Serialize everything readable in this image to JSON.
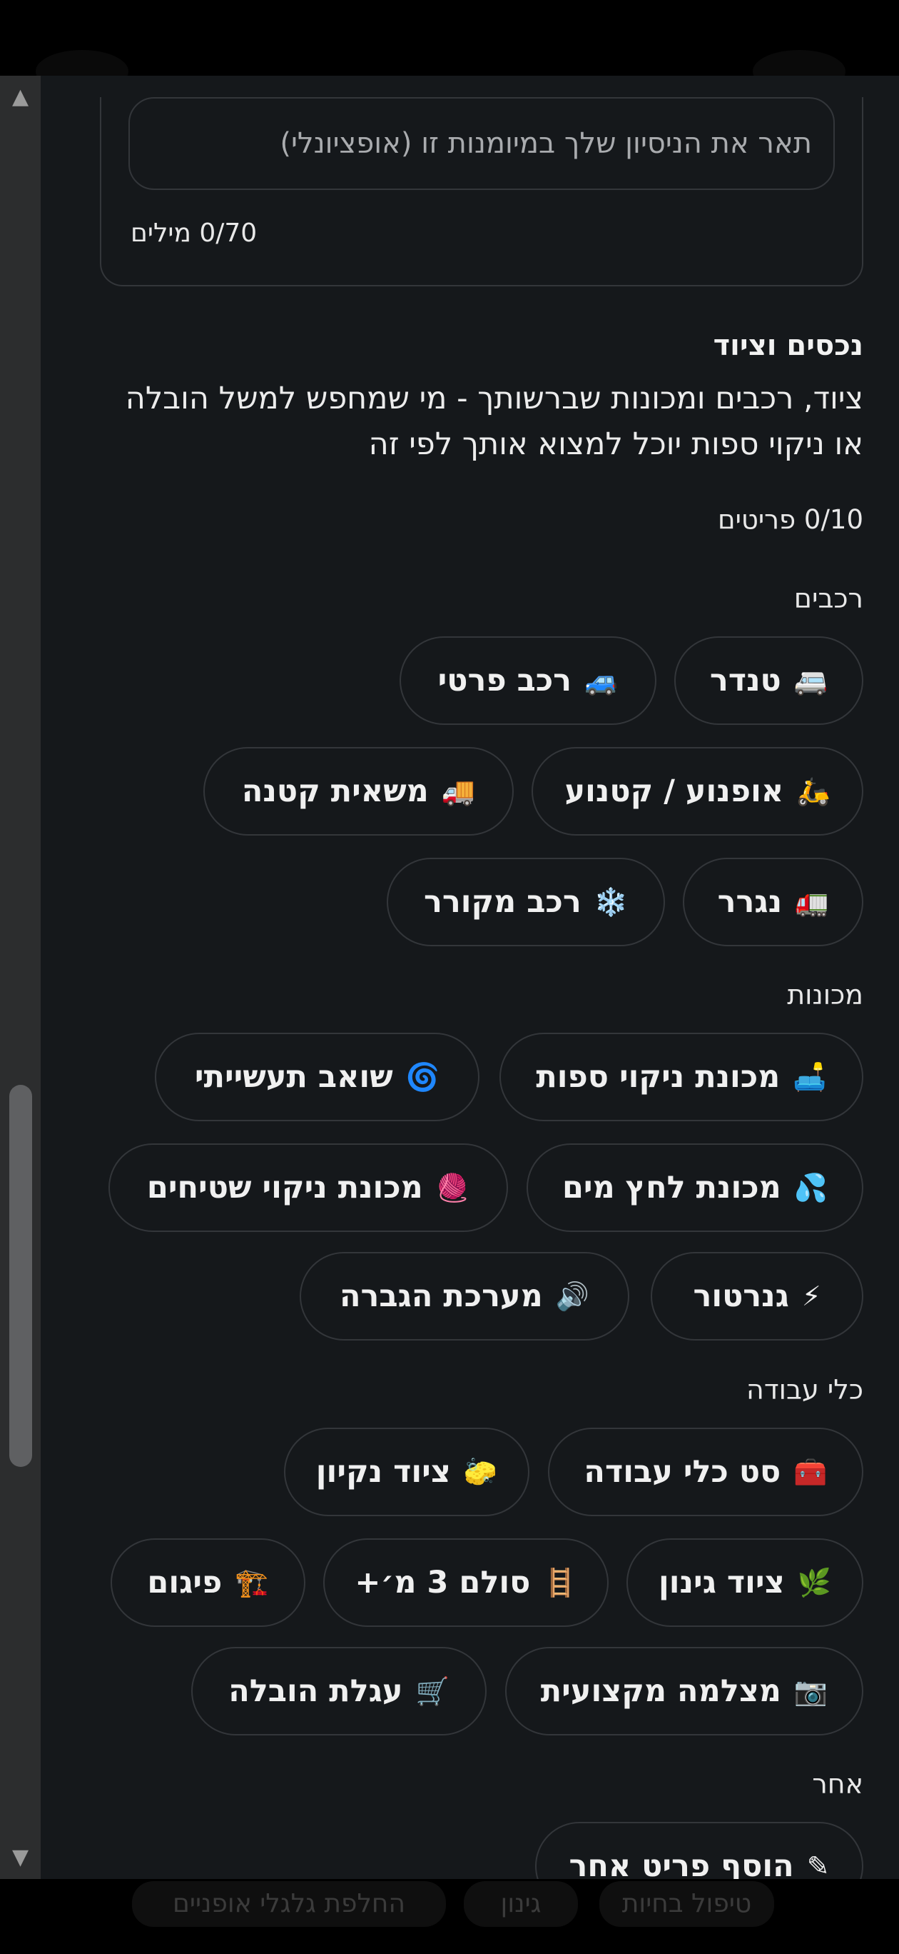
{
  "experience": {
    "placeholder": "תאר את הניסיון שלך במיומנות זו (אופציונלי)",
    "word_count": "0/70 מילים"
  },
  "assets": {
    "title": "נכסים וציוד",
    "description": "ציוד, רכבים ומכונות שברשותך - מי שמחפש למשל הובלה או ניקוי ספות יוכל למצוא אותך לפי זה",
    "item_count": "0/10 פריטים"
  },
  "categories": {
    "vehicles": "רכבים",
    "machines": "מכונות",
    "tools": "כלי עבודה",
    "other": "אחר"
  },
  "chips": {
    "tender": {
      "label": "טנדר",
      "icon": "🚐"
    },
    "private_car": {
      "label": "רכב פרטי",
      "icon": "🚙"
    },
    "motorcycle": {
      "label": "אופנוע / קטנוע",
      "icon": "🛵"
    },
    "small_truck": {
      "label": "משאית קטנה",
      "icon": "🚚"
    },
    "trailer": {
      "label": "נגרר",
      "icon": "🚛"
    },
    "refrigerated": {
      "label": "רכב מקורר",
      "icon": "❄️"
    },
    "sofa_cleaning": {
      "label": "מכונת ניקוי ספות",
      "icon": "🛋️"
    },
    "industrial_vacuum": {
      "label": "שואב תעשייתי",
      "icon": "🌀"
    },
    "pressure_washer": {
      "label": "מכונת לחץ מים",
      "icon": "💦"
    },
    "carpet_cleaning": {
      "label": "מכונת ניקוי שטיחים",
      "icon": "🧶"
    },
    "generator": {
      "label": "גנרטור",
      "icon": "⚡"
    },
    "sound_system": {
      "label": "מערכת הגברה",
      "icon": "🔊"
    },
    "toolkit": {
      "label": "סט כלי עבודה",
      "icon": "🧰"
    },
    "cleaning_gear": {
      "label": "ציוד נקיון",
      "icon": "🧽"
    },
    "gardening_gear": {
      "label": "ציוד גינון",
      "icon": "🌿"
    },
    "ladder": {
      "label": "סולם 3 מ׳+",
      "icon": "🪜"
    },
    "scaffolding": {
      "label": "פיגום",
      "icon": "🏗️"
    },
    "pro_camera": {
      "label": "מצלמה מקצועית",
      "icon": "📷"
    },
    "moving_cart": {
      "label": "עגלת הובלה",
      "icon": "🛒"
    },
    "add_other": {
      "label": "הוסף פריט אחר",
      "icon": "✎"
    }
  },
  "background_chips": [
    "טיפול בחיות",
    "גינון",
    "החלפת גלגלי אופניים"
  ],
  "scrollbar": {
    "up": "▲",
    "down": "▼"
  }
}
